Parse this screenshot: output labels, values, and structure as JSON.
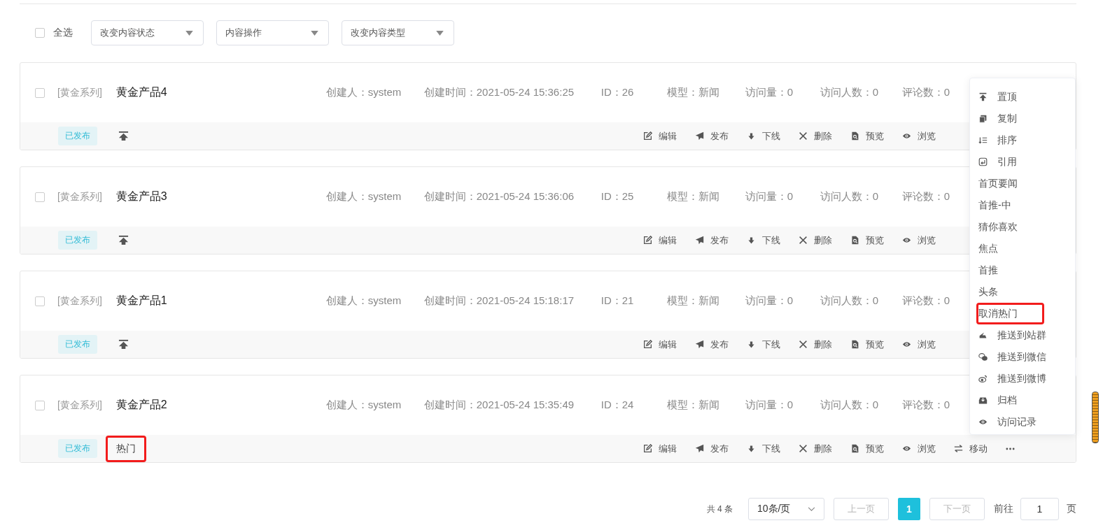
{
  "toolbar": {
    "select_all": {
      "label": "全选",
      "checked": false
    },
    "selects": [
      {
        "placeholder": "改变内容状态"
      },
      {
        "placeholder": "内容操作"
      },
      {
        "placeholder": "改变内容类型"
      }
    ]
  },
  "cards": [
    {
      "checked": false,
      "category": "[黄金系列]",
      "title": "黄金产品4",
      "meta": [
        "创建人：system",
        "创建时间：2021-05-24 15:36:25",
        "ID：26",
        "模型：新闻",
        "访问量：0",
        "访问人数：0",
        "评论数：0"
      ],
      "status": "已发布",
      "flag": {
        "kind": "pin"
      },
      "actions": [
        "编辑",
        "发布",
        "下线",
        "删除",
        "预览",
        "浏览"
      ]
    },
    {
      "checked": false,
      "category": "[黄金系列]",
      "title": "黄金产品3",
      "meta": [
        "创建人：system",
        "创建时间：2021-05-24 15:36:06",
        "ID：25",
        "模型：新闻",
        "访问量：0",
        "访问人数：0",
        "评论数：0"
      ],
      "status": "已发布",
      "flag": {
        "kind": "pin"
      },
      "actions": [
        "编辑",
        "发布",
        "下线",
        "删除",
        "预览",
        "浏览"
      ]
    },
    {
      "checked": false,
      "category": "[黄金系列]",
      "title": "黄金产品1",
      "meta": [
        "创建人：system",
        "创建时间：2021-05-24 15:18:17",
        "ID：21",
        "模型：新闻",
        "访问量：0",
        "访问人数：0",
        "评论数：0"
      ],
      "status": "已发布",
      "flag": {
        "kind": "pin"
      },
      "actions": [
        "编辑",
        "发布",
        "下线",
        "删除",
        "预览",
        "浏览"
      ]
    },
    {
      "checked": false,
      "category": "[黄金系列]",
      "title": "黄金产品2",
      "meta": [
        "创建人：system",
        "创建时间：2021-05-24 15:35:49",
        "ID：24",
        "模型：新闻",
        "访问量：0",
        "访问人数：0",
        "评论数：0"
      ],
      "status": "已发布",
      "flag": {
        "kind": "text",
        "text": "热门",
        "highlighted": true
      },
      "actions": [
        "编辑",
        "发布",
        "下线",
        "删除",
        "预览",
        "浏览",
        "移动"
      ],
      "more": true
    }
  ],
  "menu": [
    {
      "kind": "icon",
      "label": "置顶",
      "highlighted": false
    },
    {
      "kind": "icon",
      "label": "复制",
      "highlighted": false
    },
    {
      "kind": "icon",
      "label": "排序",
      "highlighted": false
    },
    {
      "kind": "icon",
      "label": "引用",
      "highlighted": false
    },
    {
      "kind": "plain",
      "label": "首页要闻",
      "highlighted": false
    },
    {
      "kind": "plain",
      "label": "首推-中",
      "highlighted": false
    },
    {
      "kind": "plain",
      "label": "猜你喜欢",
      "highlighted": false
    },
    {
      "kind": "plain",
      "label": "焦点",
      "highlighted": false
    },
    {
      "kind": "plain",
      "label": "首推",
      "highlighted": false
    },
    {
      "kind": "plain",
      "label": "头条",
      "highlighted": false
    },
    {
      "kind": "plain",
      "label": "取消热门",
      "highlighted": true
    },
    {
      "kind": "icon",
      "label": "推送到站群",
      "highlighted": false
    },
    {
      "kind": "icon",
      "label": "推送到微信",
      "highlighted": false
    },
    {
      "kind": "icon",
      "label": "推送到微博",
      "highlighted": false
    },
    {
      "kind": "icon",
      "label": "归档",
      "highlighted": false
    },
    {
      "kind": "icon",
      "label": "访问记录",
      "highlighted": false
    }
  ],
  "pagination": {
    "total": "共 4 条",
    "page_size": "10条/页",
    "prev": {
      "label": "上一页",
      "disabled": true
    },
    "pages": [
      {
        "label": "1",
        "selected": true
      }
    ],
    "next": {
      "label": "下一页",
      "disabled": true
    },
    "goto_label": "前往",
    "goto_value": "1",
    "goto_suffix": "页"
  }
}
